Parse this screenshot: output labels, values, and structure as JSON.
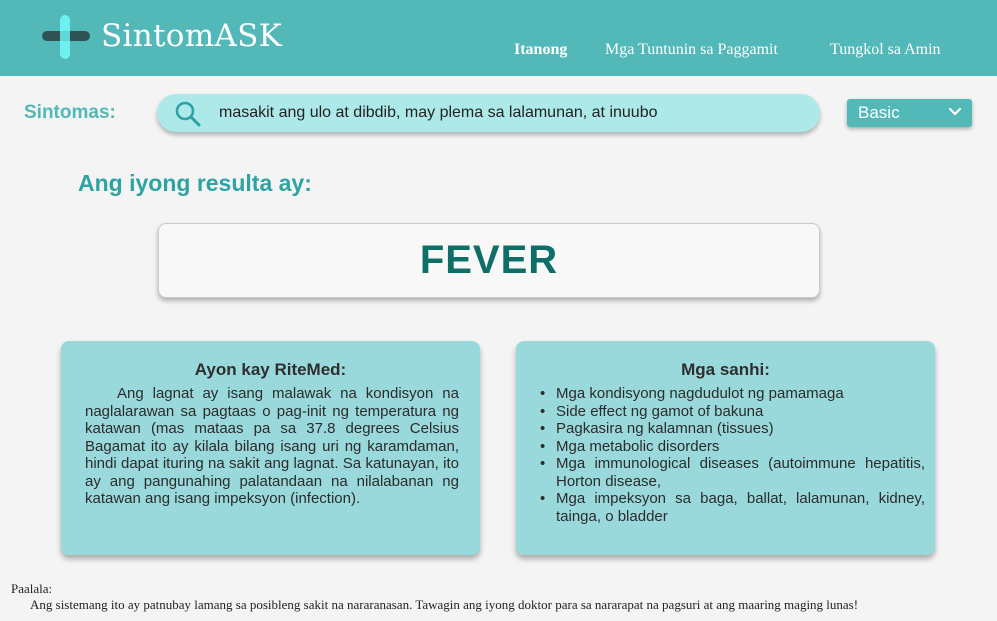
{
  "app": {
    "title": "SintomASK"
  },
  "nav": {
    "items": [
      "Itanong",
      "Mga Tuntunin sa Paggamit",
      "Tungkol sa Amin"
    ],
    "active": "Itanong"
  },
  "search": {
    "label": "Sintomas:",
    "value": "masakit ang ulo at dibdib, may plema sa lalamunan, at inuubo"
  },
  "mode": {
    "selected": "Basic"
  },
  "result": {
    "heading": "Ang iyong resulta ay:",
    "value": "FEVER"
  },
  "ritemed": {
    "title": "Ayon kay RiteMed:",
    "body": "Ang lagnat ay isang malawak na kondisyon na naglalarawan sa pagtaas o pag-init ng temperatura ng katawan (mas mataas pa sa 37.8 degrees Celsius Bagamat ito ay kilala bilang isang uri ng karamdaman, hindi dapat ituring na sakit ang lagnat. Sa katunayan, ito ay ang pangunahing palatandaan na nilalabanan ng katawan ang isang impeksyon (infection)."
  },
  "causes": {
    "title": "Mga sanhi:",
    "items": [
      "Mga kondisyong nagdudulot ng pamamaga",
      "Side effect ng gamot of bakuna",
      "Pagkasira ng kalamnan (tissues)",
      "Mga metabolic disorders",
      "Mga immunological diseases (autoimmune hepatitis, Horton disease,",
      "Mga impeksyon sa baga, ballat, lalamunan, kidney, tainga, o bladder"
    ]
  },
  "footer": {
    "label": "Paalala:",
    "text": "Ang sistemang ito ay patnubay lamang sa posibleng sakit na nararanasan. Tawagin ang iyong doktor para sa nararapat na pagsuri at ang maaring maging lunas!"
  },
  "icons": {
    "logo": "plus-cross-logo-icon",
    "search": "search-icon",
    "dropdown": "chevron-down-icon"
  },
  "colors": {
    "header": "#52b8b8",
    "accent": "#2ea3a3",
    "search_bg": "#aee9ea",
    "card_bg": "#9ad9db",
    "result_text": "#0f6e68",
    "background": "#f4f4f4"
  }
}
